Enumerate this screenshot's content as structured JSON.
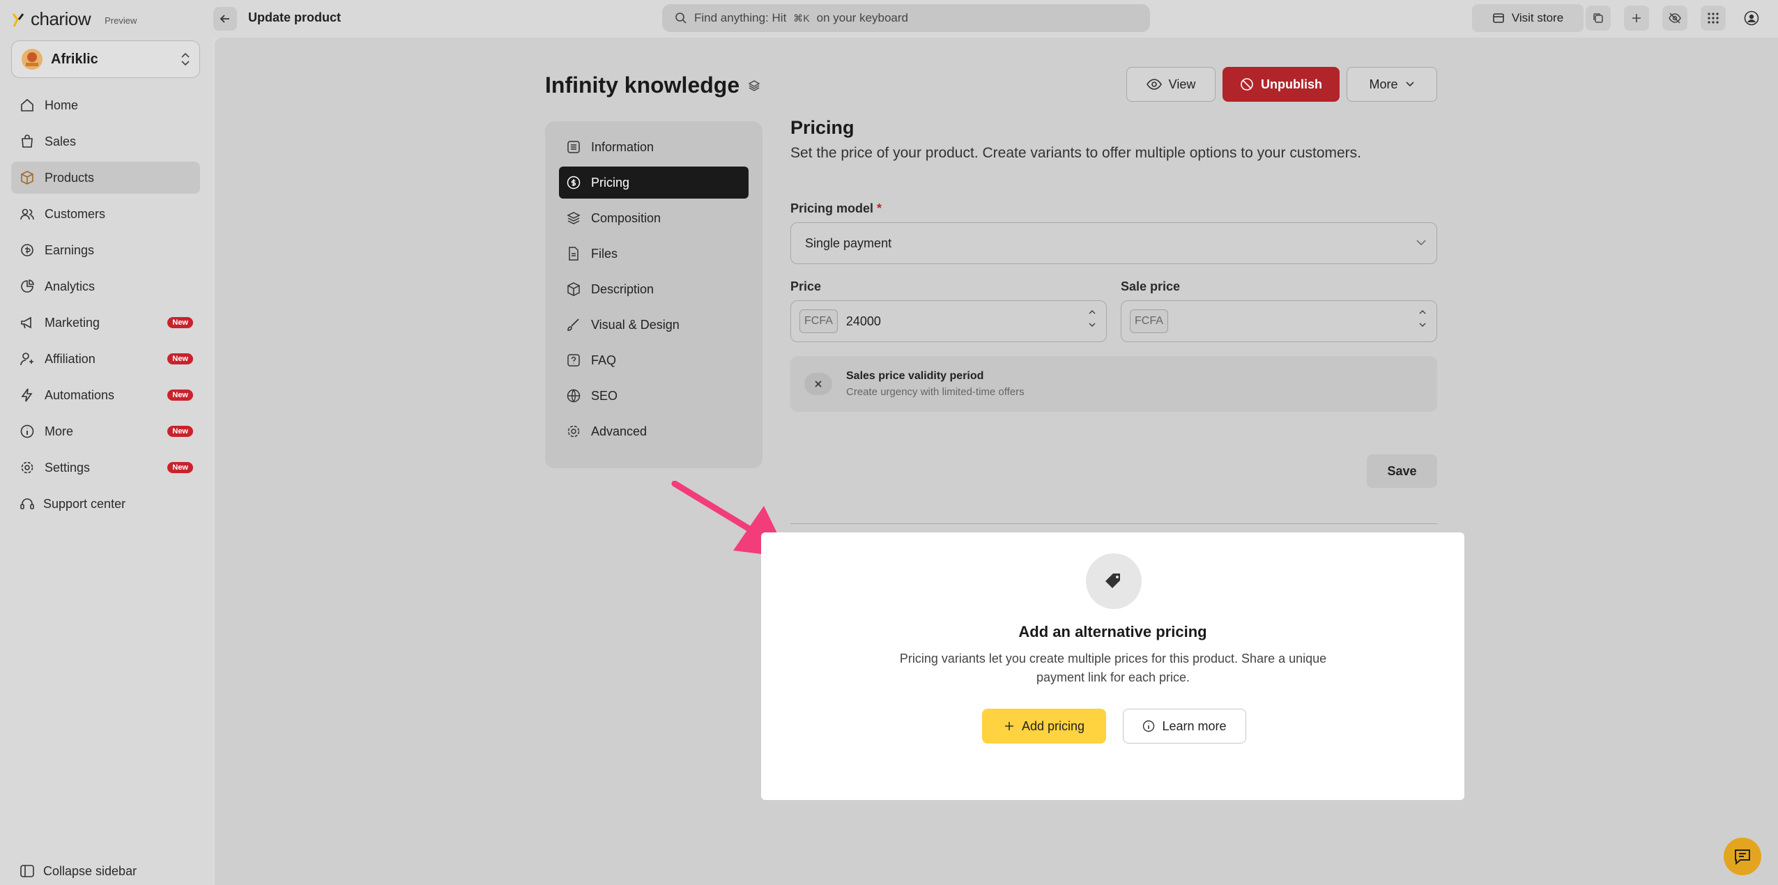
{
  "app": {
    "logo_text": "chariow",
    "preview_label": "Preview",
    "page_title": "Update product"
  },
  "search": {
    "placeholder_pre": "Find anything: Hit",
    "shortcut": "⌘K",
    "placeholder_post": "on your keyboard"
  },
  "topbar": {
    "visit_store": "Visit store"
  },
  "store": {
    "name": "Afriklic"
  },
  "sidebar": {
    "items": [
      {
        "label": "Home"
      },
      {
        "label": "Sales"
      },
      {
        "label": "Products"
      },
      {
        "label": "Customers"
      },
      {
        "label": "Earnings"
      },
      {
        "label": "Analytics"
      },
      {
        "label": "Marketing",
        "badge": "New"
      },
      {
        "label": "Affiliation",
        "badge": "New"
      },
      {
        "label": "Automations",
        "badge": "New"
      },
      {
        "label": "More",
        "badge": "New"
      },
      {
        "label": "Settings",
        "badge": "New"
      }
    ],
    "support": "Support center",
    "collapse": "Collapse sidebar"
  },
  "product": {
    "title": "Infinity knowledge",
    "view": "View",
    "unpublish": "Unpublish",
    "more": "More"
  },
  "subnav": {
    "items": [
      {
        "label": "Information"
      },
      {
        "label": "Pricing"
      },
      {
        "label": "Composition"
      },
      {
        "label": "Files"
      },
      {
        "label": "Description"
      },
      {
        "label": "Visual & Design"
      },
      {
        "label": "FAQ"
      },
      {
        "label": "SEO"
      },
      {
        "label": "Advanced"
      }
    ]
  },
  "pricing": {
    "heading": "Pricing",
    "description": "Set the price of your product. Create variants to offer multiple options to your customers.",
    "model_label": "Pricing model",
    "model_required": "*",
    "model_value": "Single payment",
    "price_label": "Price",
    "price_currency": "FCFA",
    "price_value": "24000",
    "sale_label": "Sale price",
    "sale_currency": "FCFA",
    "sale_value": "",
    "validity_title": "Sales price validity period",
    "validity_sub": "Create urgency with limited-time offers",
    "save": "Save"
  },
  "alt_pricing": {
    "title": "Add an alternative pricing",
    "desc": "Pricing variants let you create multiple prices for this product. Share a unique payment link for each price.",
    "add": "Add pricing",
    "learn": "Learn more"
  },
  "colors": {
    "accent_red": "#b1242a",
    "accent_yellow": "#ffd23f",
    "arrow_pink": "#f23d7a"
  }
}
